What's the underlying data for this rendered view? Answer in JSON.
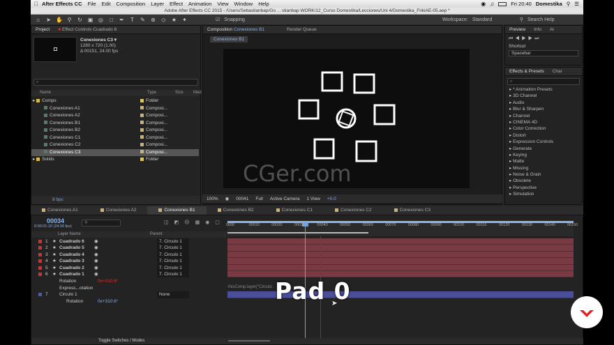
{
  "menu": {
    "app": "After Effects CC",
    "items": [
      "File",
      "Edit",
      "Composition",
      "Layer",
      "Effect",
      "Animation",
      "View",
      "Window",
      "Help"
    ],
    "clock": "Fri 20:40",
    "user": "Domestika"
  },
  "window_title": "Adobe After Effects CC 2015 - /Users/Sebastianbap/Go ... stianbap WORK/12_Curso Domestika/Lecciones/Uni 4/Domestika_FrikiAE-05.aep *",
  "toolbar": {
    "snapping": "Snapping",
    "workspace_label": "Workspace:",
    "workspace_value": "Standard",
    "search_help": "Search Help"
  },
  "project": {
    "tab_project": "Project",
    "tab_effect_controls": "Effect Controls Cuadrado 6",
    "comp_name": "Conexiones C3 ▾",
    "comp_res": "1280 x 720 (1.00)",
    "comp_dur": "Δ 00151, 24.00 fps",
    "search_placeholder": "⌕",
    "col_name": "Name",
    "col_type": "Type",
    "col_size": "Size",
    "col_media": "Med",
    "rows": [
      {
        "name": "Comps",
        "type": "Folder",
        "color": "#e0c84a",
        "indent": 0,
        "sel": false
      },
      {
        "name": "Conexiones A1",
        "type": "Composi...",
        "color": "#c9b27a",
        "indent": 1,
        "sel": false
      },
      {
        "name": "Conexiones A2",
        "type": "Composi...",
        "color": "#c9b27a",
        "indent": 1,
        "sel": false
      },
      {
        "name": "Conexiones B1",
        "type": "Composi...",
        "color": "#c9b27a",
        "indent": 1,
        "sel": false
      },
      {
        "name": "Conexiones B2",
        "type": "Composi...",
        "color": "#c9b27a",
        "indent": 1,
        "sel": false
      },
      {
        "name": "Conexiones C1",
        "type": "Composi...",
        "color": "#c9b27a",
        "indent": 1,
        "sel": false
      },
      {
        "name": "Conexiones C2",
        "type": "Composi...",
        "color": "#c9b27a",
        "indent": 1,
        "sel": false
      },
      {
        "name": "Conexiones C3",
        "type": "Composi...",
        "color": "#c9b27a",
        "indent": 1,
        "sel": true
      },
      {
        "name": "Solids",
        "type": "Folder",
        "color": "#e0c84a",
        "indent": 0,
        "sel": false
      }
    ],
    "bpc": "8 bpc"
  },
  "composition": {
    "tab_label": "Composition",
    "tab_comp": "Conexiones B1",
    "render_queue": "Render Queue",
    "sub_tab": "Conexiones B1",
    "watermark": "CGer.com",
    "zoom": "100%",
    "timecode": "00041",
    "resolution": "Full",
    "camera": "Active Camera",
    "view": "1 View",
    "exposure": "+0.0"
  },
  "right_panel": {
    "tab_preview": "Preview",
    "tab_info": "Info",
    "tab_ai": "Al",
    "shortcut_label": "Shortcut",
    "shortcut_value": "Spacebar",
    "tab_effects": "Effects & Presets",
    "tab_char": "Char",
    "search_placeholder": "⌕",
    "effects": [
      "* Animation Presets",
      "3D Channel",
      "Audio",
      "Blur & Sharpen",
      "Channel",
      "CINEMA 4D",
      "Color Correction",
      "Distort",
      "Expression Controls",
      "Generate",
      "Keying",
      "Matte",
      "Missing",
      "Noise & Grain",
      "Obsolete",
      "Perspective",
      "Simulation"
    ]
  },
  "timeline": {
    "tabs": [
      "Conexiones A1",
      "Conexiones A2",
      "Conexiones B1",
      "Conexiones B2",
      "Conexiones C1",
      "Conexiones C2",
      "Conexiones C3"
    ],
    "active_tab": 2,
    "current_time": "00034",
    "time_sub": "0:00:01:10 (24.00 fps)",
    "col_layer_name": "Layer Name",
    "col_parent": "Parent",
    "ticks": [
      "0000",
      "00010",
      "00020",
      "00030",
      "00040",
      "00050",
      "00060",
      "00070",
      "00080",
      "00090",
      "00100",
      "00110",
      "00120",
      "00130",
      "00140",
      "00150"
    ],
    "layers": [
      {
        "num": "1",
        "name": "Cuadrado 6",
        "parent": "7. Circulo 1"
      },
      {
        "num": "2",
        "name": "Cuadrado 5",
        "parent": "7. Circulo 1"
      },
      {
        "num": "3",
        "name": "Cuadrado 4",
        "parent": "7. Circulo 1"
      },
      {
        "num": "4",
        "name": "Cuadrado 3",
        "parent": "7. Circulo 1"
      },
      {
        "num": "5",
        "name": "Cuadrado 2",
        "parent": "7. Circulo 1"
      },
      {
        "num": "6",
        "name": "Cuadrado 1",
        "parent": "7. Circulo 1"
      }
    ],
    "rotation_label": "Rotation",
    "rotation_value": "0x+310.6°",
    "expression_label": "Express...otation",
    "expression_text": "thisComp.layer(\"Circulo",
    "circle_layer": {
      "num": "7",
      "name": "Circulo 1",
      "parent": "None"
    },
    "circle_rotation_value": "0x+310.6°",
    "overlay_text": "Pad 0",
    "toggle_label": "Toggle Switches / Modes"
  }
}
